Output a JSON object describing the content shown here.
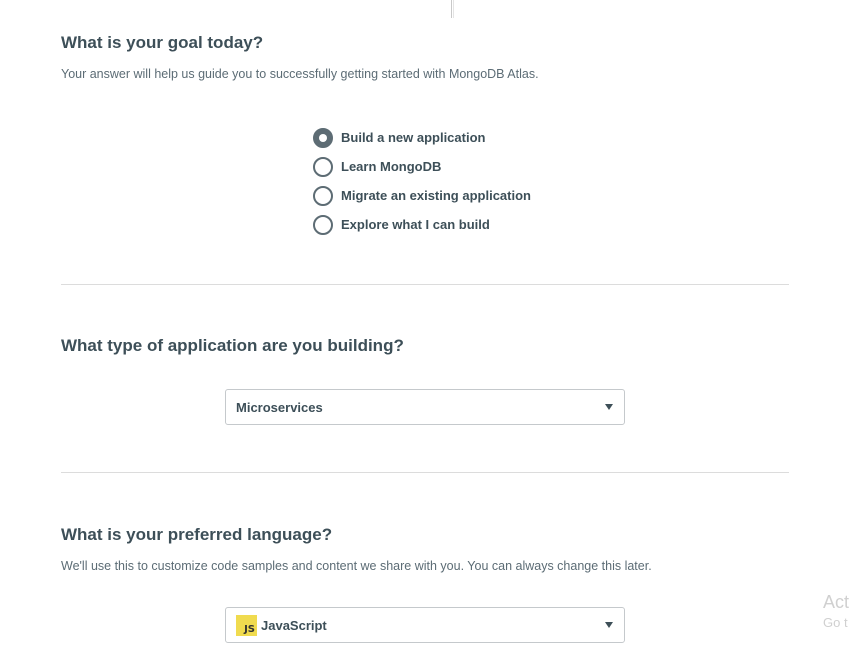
{
  "goal": {
    "title": "What is your goal today?",
    "subtitle": "Your answer will help us guide you to successfully getting started with MongoDB Atlas.",
    "options": [
      {
        "label": "Build a new application",
        "checked": true
      },
      {
        "label": "Learn MongoDB",
        "checked": false
      },
      {
        "label": "Migrate an existing application",
        "checked": false
      },
      {
        "label": "Explore what I can build",
        "checked": false
      }
    ]
  },
  "app_type": {
    "title": "What type of application are you building?",
    "selected": "Microservices"
  },
  "language": {
    "title": "What is your preferred language?",
    "subtitle": "We'll use this to customize code samples and content we share with you. You can always change this later.",
    "selected": "JavaScript",
    "icon": "javascript-logo-icon",
    "icon_text": "JS",
    "icon_color": "#f0db4f"
  },
  "watermark": {
    "line1": "Act",
    "line2": "Go t"
  }
}
